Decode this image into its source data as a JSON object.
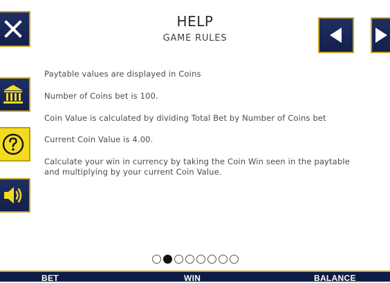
{
  "header": {
    "title": "HELP",
    "subtitle": "GAME RULES"
  },
  "controls": {
    "close_icon": "close-icon",
    "prev_icon": "triangle-left-icon",
    "next_icon": "triangle-right-icon",
    "side": [
      {
        "name": "paytable",
        "icon": "bank-icon"
      },
      {
        "name": "help",
        "icon": "question-icon"
      },
      {
        "name": "sound",
        "icon": "speaker-icon"
      }
    ]
  },
  "rules": [
    "Paytable values are displayed in Coins",
    "Number of Coins bet is 100.",
    "Coin Value is calculated by dividing Total Bet by Number of Coins bet",
    "Current Coin Value is 4.00.",
    "Calculate your win in currency by taking the Coin Win seen in the paytable and multiplying by your current Coin Value."
  ],
  "pagination": {
    "total_pages": 8,
    "current_page": 2
  },
  "bottom_bar": {
    "bet_label": "BET",
    "win_label": "WIN",
    "balance_label": "BALANCE"
  },
  "colors": {
    "button_navy": "#1a2a5c",
    "button_border_gold": "#c9a227",
    "help_button_yellow": "#f3dc1e"
  }
}
